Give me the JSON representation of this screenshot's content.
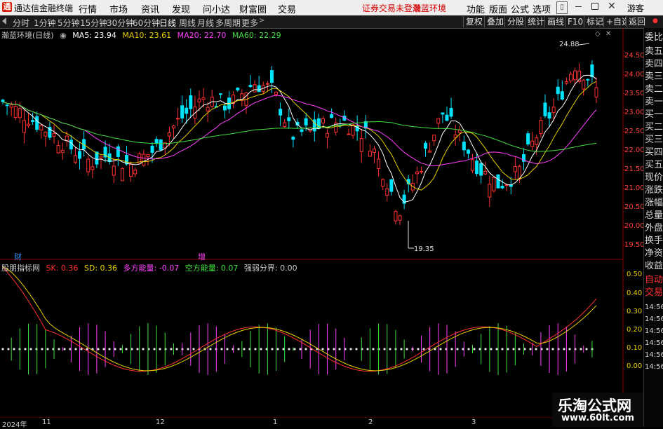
{
  "titlebar": {
    "app_title": "通达信金融终端",
    "menus": [
      "行情",
      "市场",
      "资讯",
      "发现",
      "问小达",
      "财富圈",
      "交易"
    ],
    "status_warning": "证券交易未登录",
    "status_env": "瀚蓝环境",
    "right_menus": [
      "功能",
      "版面",
      "公式",
      "选项"
    ],
    "user": "游客"
  },
  "toolbar": {
    "periods": [
      "分时",
      "1分钟",
      "5分钟",
      "15分钟",
      "30分钟",
      "60分钟",
      "日线",
      "周线",
      "月线",
      "多周期",
      "更多"
    ],
    "active_period": "日线",
    "right_buttons": [
      "复权",
      "叠加",
      "分股",
      "统计",
      "画线",
      "F10",
      "标记",
      "+自选",
      "返回"
    ]
  },
  "ma_legend": {
    "title": "瀚蓝环境(日线)",
    "ma5": "MA5: 23.94",
    "ma10": "MA10: 23.61",
    "ma20": "MA20: 22.70",
    "ma60": "MA60: 22.29"
  },
  "price_axis": [
    "24.50",
    "24.00",
    "23.50",
    "23.00",
    "22.50",
    "22.00",
    "21.50",
    "21.00",
    "20.50",
    "20.00",
    "19.50"
  ],
  "indicator_axis": [
    "0.50",
    "0.40",
    "0.30",
    "0.20",
    "0.10",
    "0.00"
  ],
  "annotations": {
    "high": "24.88",
    "low": "19.35"
  },
  "event_markers": {
    "cai": "财",
    "zeng": "增"
  },
  "indicator_legend": {
    "name": "股朋指标网",
    "sk": "SK: 0.36",
    "sd": "SD: 0.36",
    "long": "多方能量: -0.07",
    "short": "空方能量: 0.07",
    "boundary": "强弱分界: 0.00"
  },
  "sidebar": {
    "items": [
      "委比",
      "卖五",
      "卖四",
      "卖三",
      "卖二",
      "卖一",
      "买一",
      "买二",
      "买三",
      "买四",
      "买五",
      "现价",
      "涨跌",
      "涨幅",
      "总量",
      "外盘",
      "换手",
      "净资",
      "收益",
      "自动",
      "交易"
    ],
    "times": [
      "14:56",
      "14:56",
      "14:56",
      "14:56",
      "14:56",
      "14:56"
    ]
  },
  "xaxis": {
    "labels": [
      "2024年",
      "11",
      "12",
      "1",
      "2",
      "3"
    ]
  },
  "watermark": {
    "line1": "乐淘公式网",
    "line2": "www.60lt.com"
  },
  "colors": {
    "up": "#ff3030",
    "down": "#00e5ff",
    "ma5": "#ffffff",
    "ma10": "#e8d000",
    "ma20": "#ff40ff",
    "ma60": "#40e040"
  }
}
